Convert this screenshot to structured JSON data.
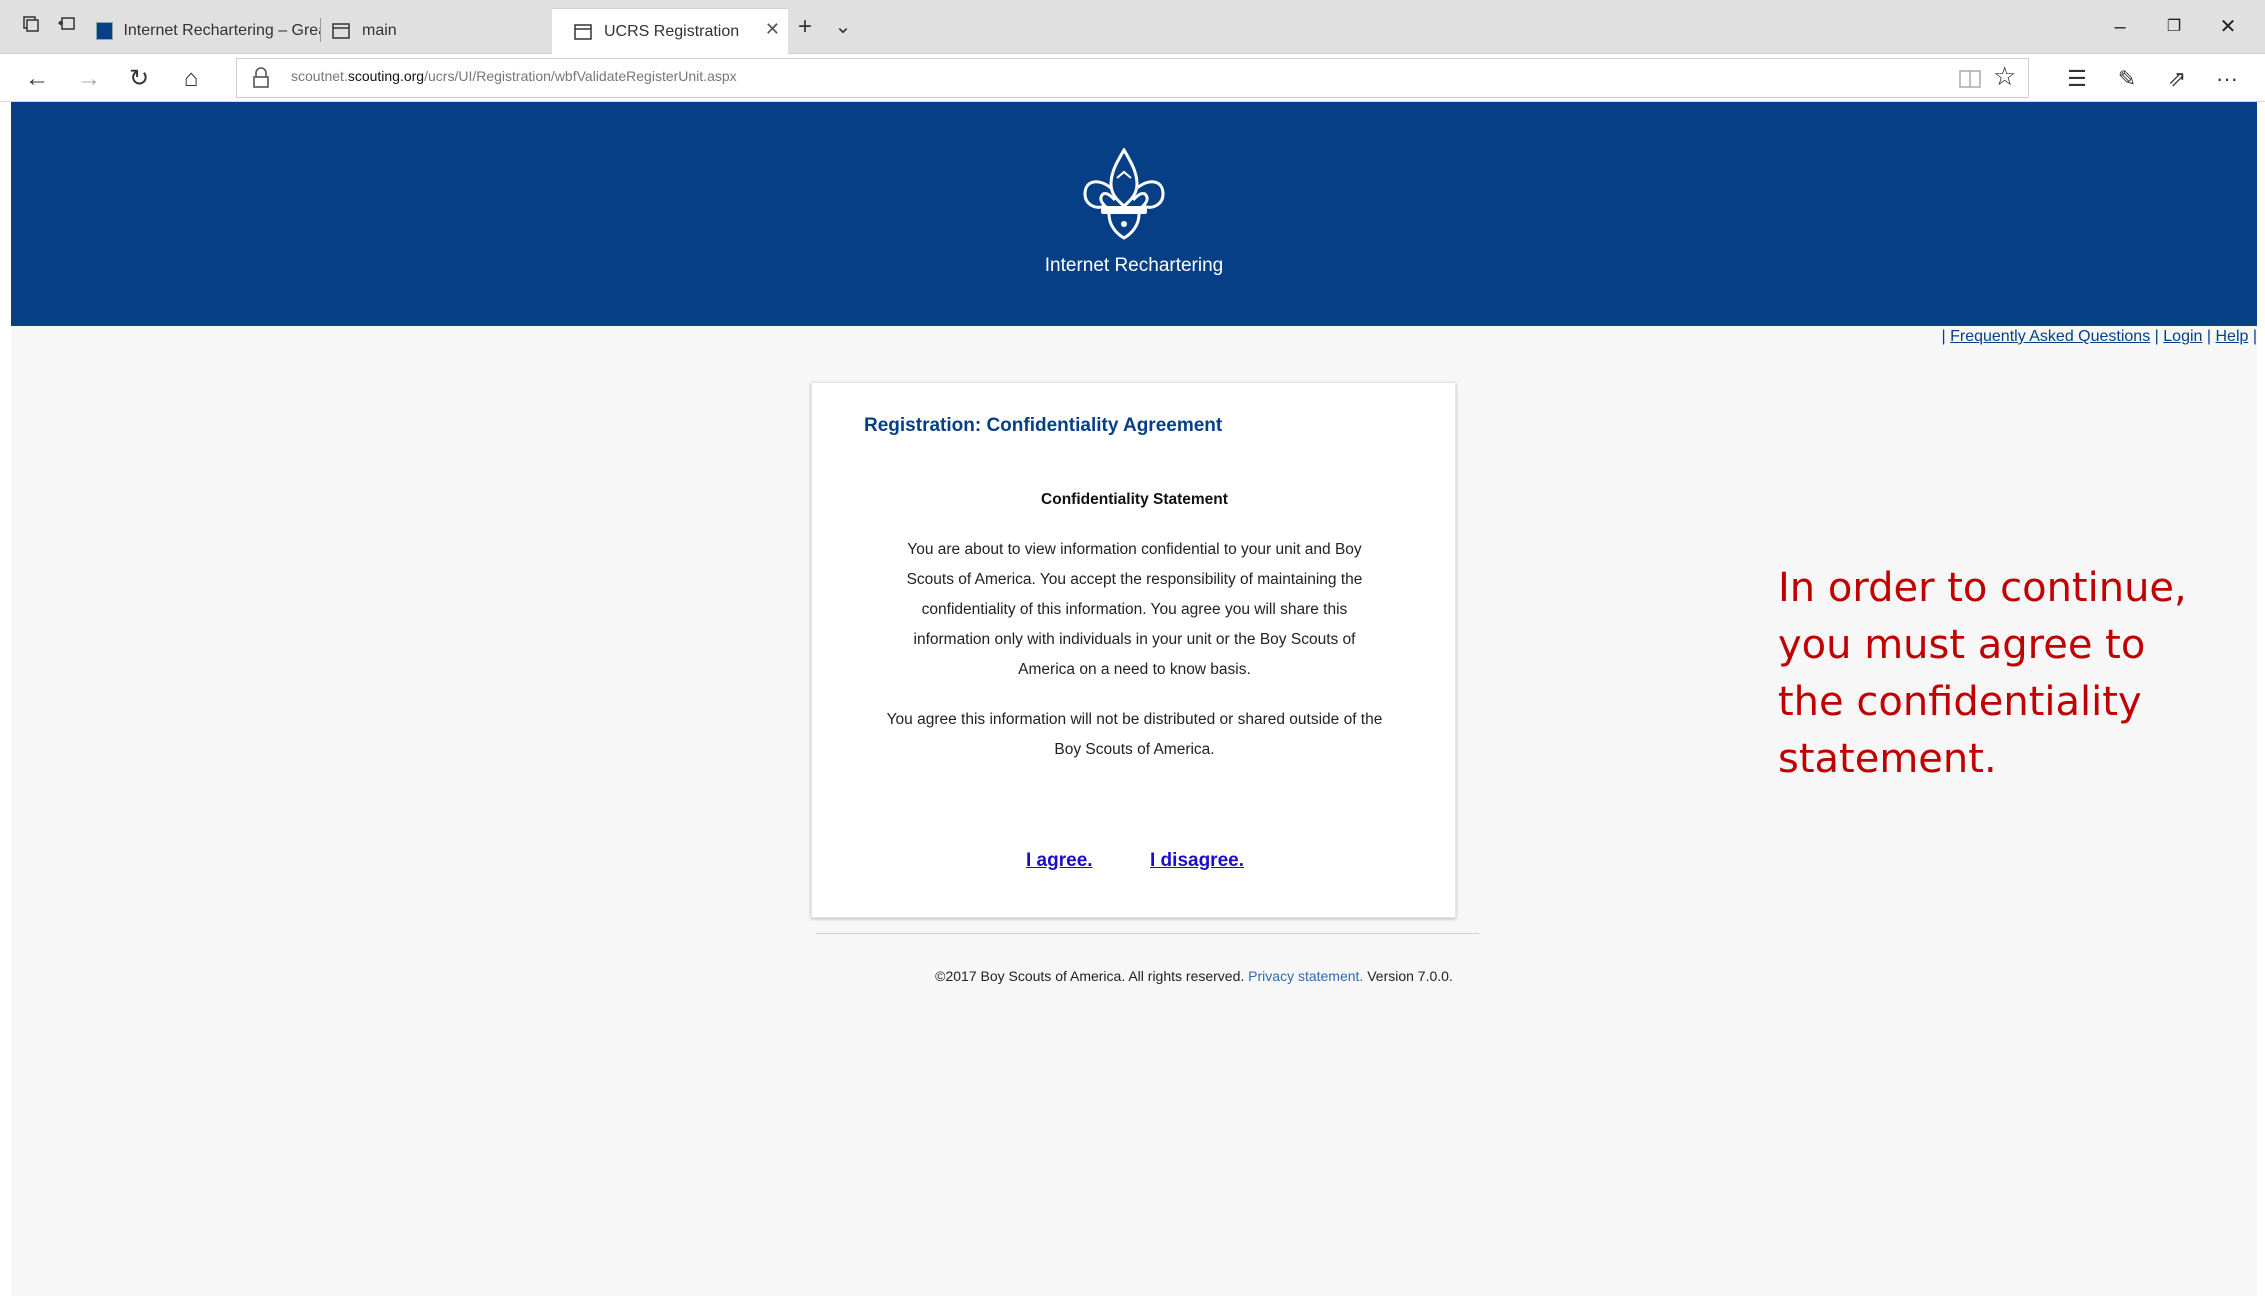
{
  "browser": {
    "tabs": [
      {
        "title": "Internet Rechartering – Grea",
        "active": false
      },
      {
        "title": "main",
        "active": false
      },
      {
        "title": "UCRS Registration",
        "active": true
      }
    ],
    "new_tab_symbol": "+",
    "tab_list_symbol": "⌄",
    "address": {
      "prefix": "scoutnet.",
      "domain": "scouting.org",
      "path": "/ucrs/UI/Registration/wbfValidateRegisterUnit.aspx"
    },
    "icons": {
      "back": "←",
      "forward": "→",
      "refresh": "↻",
      "home": "⌂",
      "reading_view": "📖",
      "favorite": "☆",
      "favorites_list": "☰",
      "pen": "✎",
      "share": "⇗",
      "more": "···",
      "minimize": "–",
      "restore": "❐",
      "close": "✕",
      "tab_close": "✕"
    }
  },
  "site": {
    "title": "Internet Rechartering",
    "links": {
      "sep": "|",
      "faq": "Frequently Asked Questions",
      "login": "Login",
      "help": "Help"
    }
  },
  "card": {
    "heading": "Registration: Confidentiality Agreement",
    "statement_title": "Confidentiality Statement",
    "lines1": [
      "You are about to view information confidential to your unit and Boy",
      "Scouts of America. You accept the responsibility of maintaining the",
      "confidentiality of this information. You agree you will share this",
      "information only with individuals in your unit or the Boy Scouts of",
      "America on a need to know basis."
    ],
    "lines2": [
      "You agree this information will not be distributed or shared outside of the",
      "Boy Scouts of America."
    ],
    "agree": "I agree.",
    "disagree": "I disagree."
  },
  "footer": {
    "copyright": "©2017 Boy Scouts of America. All rights reserved.",
    "privacy": "Privacy statement.",
    "version": "Version 7.0.0."
  },
  "callout": {
    "lines": [
      "In order to continue,",
      "you must agree to",
      "the confidentiality",
      "statement."
    ]
  },
  "colors": {
    "header_blue": "#063f86",
    "link_blue": "#1a0dcc",
    "callout_red": "#c00000"
  }
}
